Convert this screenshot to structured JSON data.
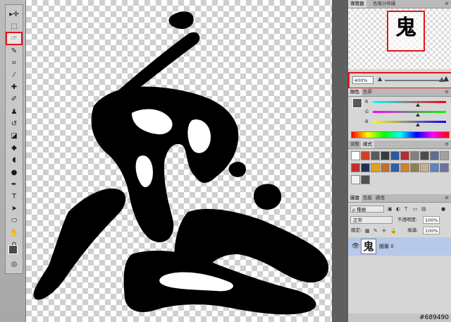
{
  "tools": [
    {
      "name": "move-tool",
      "glyph": "▸✛"
    },
    {
      "name": "marquee-tool",
      "glyph": "⬚"
    },
    {
      "name": "quick-selection-tool",
      "glyph": "☞"
    },
    {
      "name": "brush-tool-1",
      "glyph": "✎"
    },
    {
      "name": "crop-tool",
      "glyph": "⌗"
    },
    {
      "name": "eyedropper-tool",
      "glyph": "⁄"
    },
    {
      "name": "healing-tool",
      "glyph": "✚"
    },
    {
      "name": "brush-tool",
      "glyph": "✐"
    },
    {
      "name": "clone-stamp-tool",
      "glyph": "♟"
    },
    {
      "name": "history-brush-tool",
      "glyph": "↺"
    },
    {
      "name": "eraser-tool",
      "glyph": "◪"
    },
    {
      "name": "paint-bucket-tool",
      "glyph": "◆"
    },
    {
      "name": "blur-tool",
      "glyph": "◖"
    },
    {
      "name": "dodge-tool",
      "glyph": "●"
    },
    {
      "name": "pen-tool",
      "glyph": "✒"
    },
    {
      "name": "type-tool",
      "glyph": "T"
    },
    {
      "name": "path-selection-tool",
      "glyph": "➤"
    },
    {
      "name": "shape-tool",
      "glyph": "⬭"
    },
    {
      "name": "hand-tool",
      "glyph": "✋"
    },
    {
      "name": "zoom-tool",
      "glyph": "⚲"
    }
  ],
  "highlighted_tool": "quick-selection-tool",
  "toolbar_extra": {
    "quick_mask": "◎",
    "screen_mode": "▭"
  },
  "panels": {
    "navigator_tabs": [
      "導覽器",
      "色階分佈圖"
    ],
    "zoom": {
      "value": "400%",
      "level": 0.97
    },
    "color_tabs": [
      "顏色",
      "色票"
    ],
    "color_sliders": [
      {
        "label": "R",
        "position": 0.62,
        "gradient": [
          "#00ffff",
          "#ff0000"
        ]
      },
      {
        "label": "G",
        "position": 0.62,
        "gradient": [
          "#ff00ff",
          "#00ff00"
        ]
      },
      {
        "label": "B",
        "position": 0.62,
        "gradient": [
          "#ffff00",
          "#0000ff"
        ]
      }
    ],
    "styles_tabs": [
      "調整",
      "樣式"
    ],
    "style_colors": [
      "#ffffff",
      "#d04020",
      "#5a5a5a",
      "#3a3a3a",
      "#2a5aa0",
      "#b03030",
      "#808080",
      "#4a4a4a",
      "#5a7090",
      "#a0a0a0",
      "#c03030",
      "#203050",
      "#e0a020",
      "#c07030",
      "#3060a0",
      "#d08030",
      "#908050",
      "#c0b090",
      "#6080c0",
      "#7070a0",
      "#f0f0f0",
      "#505050"
    ],
    "layers_tabs": [
      "圖層",
      "色版",
      "路徑"
    ],
    "layers": {
      "filter_label": "ρ 種類",
      "blend_mode": "正常",
      "opacity_label": "不透明度:",
      "opacity_value": "100%",
      "lock_label": "鎖定:",
      "fill_label": "填滿:",
      "fill_value": "100%",
      "layer_name": "圖層 0",
      "thumb_glyph": "鬼"
    },
    "navigator_glyph": "鬼",
    "watermark": "#689490"
  }
}
